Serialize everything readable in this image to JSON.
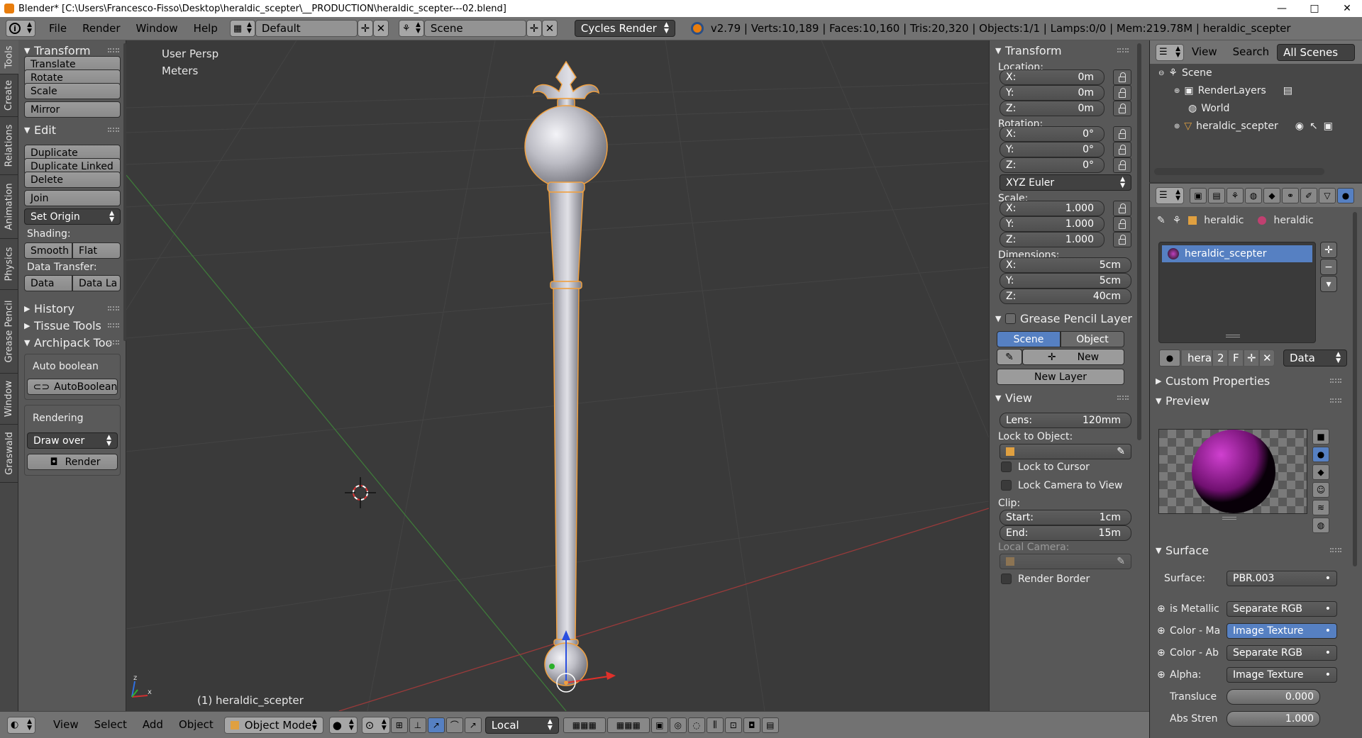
{
  "window": {
    "title": "Blender* [C:\\Users\\Francesco-Fisso\\Desktop\\heraldic_scepter\\__PRODUCTION\\heraldic_scepter---02.blend]",
    "minimize": "—",
    "maximize": "□",
    "close": "✕"
  },
  "info_bar": {
    "menus": [
      "File",
      "Render",
      "Window",
      "Help"
    ],
    "layout": "Default",
    "scene": "Scene",
    "engine": "Cycles Render",
    "stats": "v2.79 | Verts:10,189 | Faces:10,160 | Tris:20,320 | Objects:1/1 | Lamps:0/0 | Mem:219.78M | heraldic_scepter"
  },
  "side_tabs": [
    "Tools",
    "Create",
    "Relations",
    "Animation",
    "Physics",
    "Grease Pencil",
    "Window",
    "Graswald"
  ],
  "toolshelf": {
    "transform": {
      "title": "Transform",
      "buttons": [
        "Translate",
        "Rotate",
        "Scale",
        "Mirror"
      ]
    },
    "edit": {
      "title": "Edit",
      "buttons": [
        "Duplicate",
        "Duplicate Linked",
        "Delete",
        "Join"
      ],
      "set_origin": "Set Origin",
      "shading_label": "Shading:",
      "smooth": "Smooth",
      "flat": "Flat",
      "data_transfer_label": "Data Transfer:",
      "data": "Data",
      "data_layout": "Data La"
    },
    "history": "History",
    "tissue": "Tissue Tools",
    "archipack": {
      "title": "Archipack Too",
      "auto_boolean_label": "Auto boolean",
      "auto_boolean_button": "AutoBoolean",
      "rendering_label": "Rendering",
      "draw_over": "Draw over",
      "render": "Render"
    }
  },
  "viewport": {
    "view_name": "User Persp",
    "units": "Meters",
    "object_label": "(1) heraldic_scepter"
  },
  "npanel": {
    "transform_title": "Transform",
    "location_label": "Location:",
    "location": [
      {
        "axis": "X:",
        "value": "0m"
      },
      {
        "axis": "Y:",
        "value": "0m"
      },
      {
        "axis": "Z:",
        "value": "0m"
      }
    ],
    "rotation_label": "Rotation:",
    "rotation": [
      {
        "axis": "X:",
        "value": "0°"
      },
      {
        "axis": "Y:",
        "value": "0°"
      },
      {
        "axis": "Z:",
        "value": "0°"
      }
    ],
    "rotation_mode": "XYZ Euler",
    "scale_label": "Scale:",
    "scale": [
      {
        "axis": "X:",
        "value": "1.000"
      },
      {
        "axis": "Y:",
        "value": "1.000"
      },
      {
        "axis": "Z:",
        "value": "1.000"
      }
    ],
    "dimensions_label": "Dimensions:",
    "dimensions": [
      {
        "axis": "X:",
        "value": "5cm"
      },
      {
        "axis": "Y:",
        "value": "5cm"
      },
      {
        "axis": "Z:",
        "value": "40cm"
      }
    ],
    "grease_title": "Grease Pencil Layer",
    "scene_tab": "Scene",
    "object_tab": "Object",
    "new": "New",
    "new_layer": "New Layer",
    "view_title": "View",
    "lens_label": "Lens:",
    "lens_value": "120mm",
    "lock_object_label": "Lock to Object:",
    "lock_cursor": "Lock to Cursor",
    "lock_camera": "Lock Camera to View",
    "clip_label": "Clip:",
    "clip_start_label": "Start:",
    "clip_start": "1cm",
    "clip_end_label": "End:",
    "clip_end": "15m",
    "local_camera": "Local Camera:",
    "render_border": "Render Border"
  },
  "outliner": {
    "view": "View",
    "search": "Search",
    "all_scenes": "All Scenes",
    "rows": [
      "Scene",
      "RenderLayers",
      "World",
      "heraldic_scepter"
    ]
  },
  "properties": {
    "breadcrumb": [
      "heraldic",
      "heraldic"
    ],
    "material_slot": "heraldic_scepter",
    "mat_name": "hera",
    "users": "2",
    "fake": "F",
    "link": "Data",
    "custom_props": "Custom Properties",
    "preview": "Preview",
    "surface_title": "Surface",
    "surface_label": "Surface:",
    "surface_value": "PBR.003",
    "inputs": [
      {
        "label": "is Metallic",
        "value": "Separate RGB"
      },
      {
        "label": "Color - Ma",
        "value": "Image Texture"
      },
      {
        "label": "Color - Ab",
        "value": "Separate RGB"
      },
      {
        "label": "Alpha:",
        "value": "Image Texture"
      }
    ],
    "translucency_label": "Transluce",
    "translucency_value": "0.000",
    "abs_label": "Abs Stren",
    "abs_value": "1.000"
  },
  "bottom_bar": {
    "menus": [
      "View",
      "Select",
      "Add",
      "Object"
    ],
    "mode": "Object Mode",
    "pivot": "Local"
  },
  "colors": {
    "accent_blue": "#5680c2",
    "header_gray": "#727272",
    "panel_gray": "#585858",
    "viewport_bg": "#3a3a3a",
    "object_outline": "#f0a040"
  }
}
